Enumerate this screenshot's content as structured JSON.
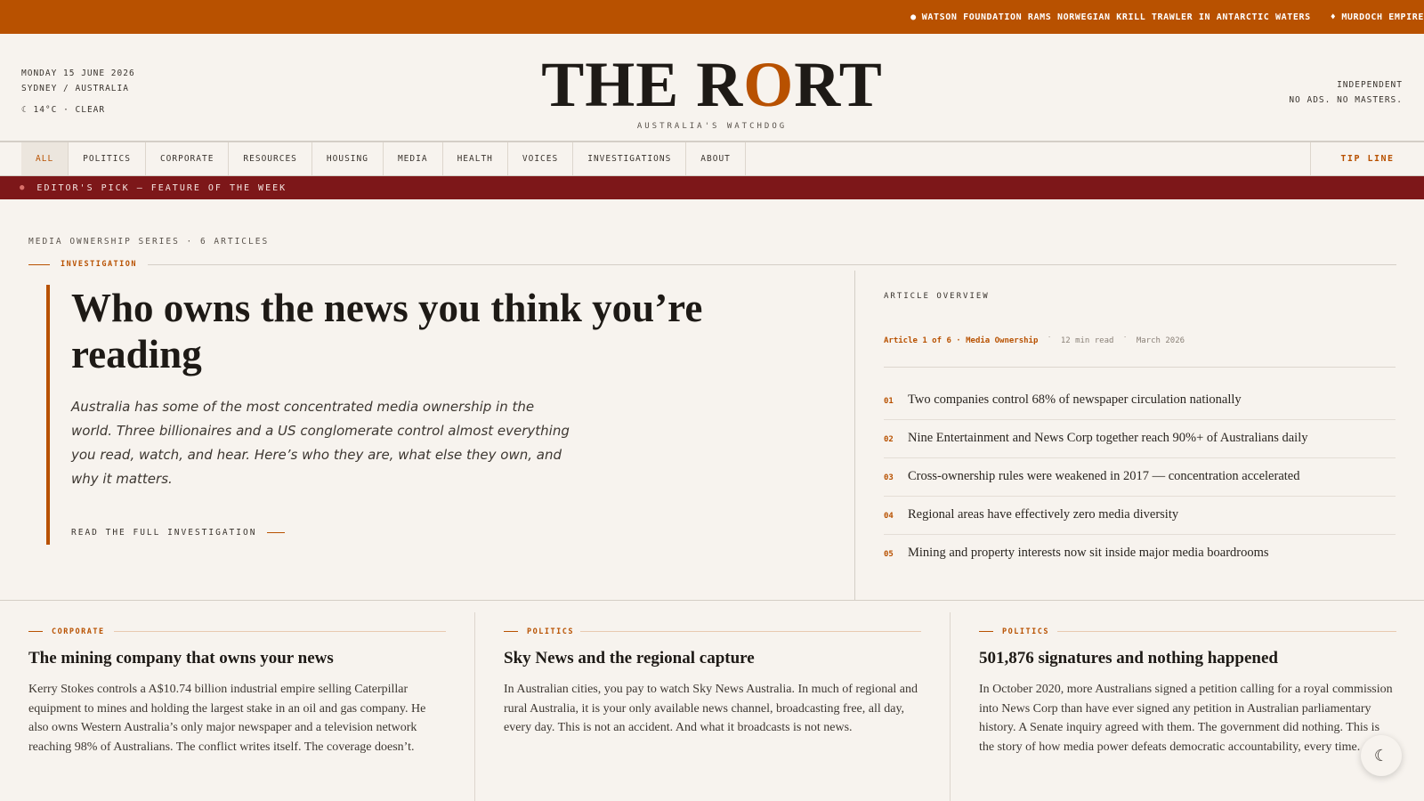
{
  "ticker": {
    "items": [
      "WATSON FOUNDATION RAMS NORWEGIAN KRILL TRAWLER IN ANTARCTIC WATERS",
      "MURDOCH EMPIRE"
    ]
  },
  "masthead": {
    "date": "MONDAY 15 JUNE 2026",
    "location": "SYDNEY / AUSTRALIA",
    "weather": "14°C · CLEAR",
    "logo_part1": "THE R",
    "logo_accent": "O",
    "logo_part2": "RT",
    "tagline": "AUSTRALIA'S WATCHDOG",
    "right_line1": "INDEPENDENT",
    "right_line2": "NO ADS. NO MASTERS."
  },
  "nav": {
    "items": [
      "ALL",
      "POLITICS",
      "CORPORATE",
      "RESOURCES",
      "HOUSING",
      "MEDIA",
      "HEALTH",
      "VOICES",
      "INVESTIGATIONS",
      "ABOUT"
    ],
    "active": "ALL",
    "tip_line": "TIP LINE"
  },
  "editors_pick": {
    "dot": "●",
    "label": "EDITOR'S PICK — FEATURE OF THE WEEK"
  },
  "feature": {
    "series_label": "MEDIA OWNERSHIP SERIES · 6 ARTICLES",
    "kicker": "INVESTIGATION",
    "headline": "Who owns the news you think you’re reading",
    "dek": "Australia has some of the most concentrated media ownership in the world. Three billionaires and a US conglomerate control almost everything you read, watch, and hear. Here’s who they are, what else they own, and why it matters.",
    "read_more": "READ THE FULL INVESTIGATION"
  },
  "overview": {
    "title": "ARTICLE OVERVIEW",
    "series": "Article 1 of 6 · Media Ownership",
    "read_time": "12 min read",
    "date": "March 2026",
    "points": [
      {
        "num": "01",
        "text": "Two companies control 68% of newspaper circulation nationally"
      },
      {
        "num": "02",
        "text": "Nine Entertainment and News Corp together reach 90%+ of Australians daily"
      },
      {
        "num": "03",
        "text": "Cross-ownership rules were weakened in 2017 — concentration accelerated"
      },
      {
        "num": "04",
        "text": "Regional areas have effectively zero media diversity"
      },
      {
        "num": "05",
        "text": "Mining and property interests now sit inside major media boardrooms"
      }
    ]
  },
  "cards": [
    {
      "kicker": "CORPORATE",
      "title": "The mining company that owns your news",
      "body": "Kerry Stokes controls a A$10.74 billion industrial empire selling Caterpillar equipment to mines and holding the largest stake in an oil and gas company. He also owns Western Australia’s only major newspaper and a television network reaching 98% of Australians. The conflict writes itself. The coverage doesn’t."
    },
    {
      "kicker": "POLITICS",
      "title": "Sky News and the regional capture",
      "body": "In Australian cities, you pay to watch Sky News Australia. In much of regional and rural Australia, it is your only available news channel, broadcasting free, all day, every day. This is not an accident. And what it broadcasts is not news."
    },
    {
      "kicker": "POLITICS",
      "title": "501,876 signatures and nothing happened",
      "body": "In October 2020, more Australians signed a petition calling for a royal commission into News Corp than have ever signed any petition in Australian parliamentary history. A Senate inquiry agreed with them. The government did nothing. This is the story of how media power defeats democratic accountability, every time."
    }
  ],
  "theme_toggle": {
    "icon": "moon-icon",
    "glyph": "☾"
  },
  "colors": {
    "accent": "#b85100",
    "pick_bar": "#7d1719",
    "background": "#f7f3ee"
  }
}
